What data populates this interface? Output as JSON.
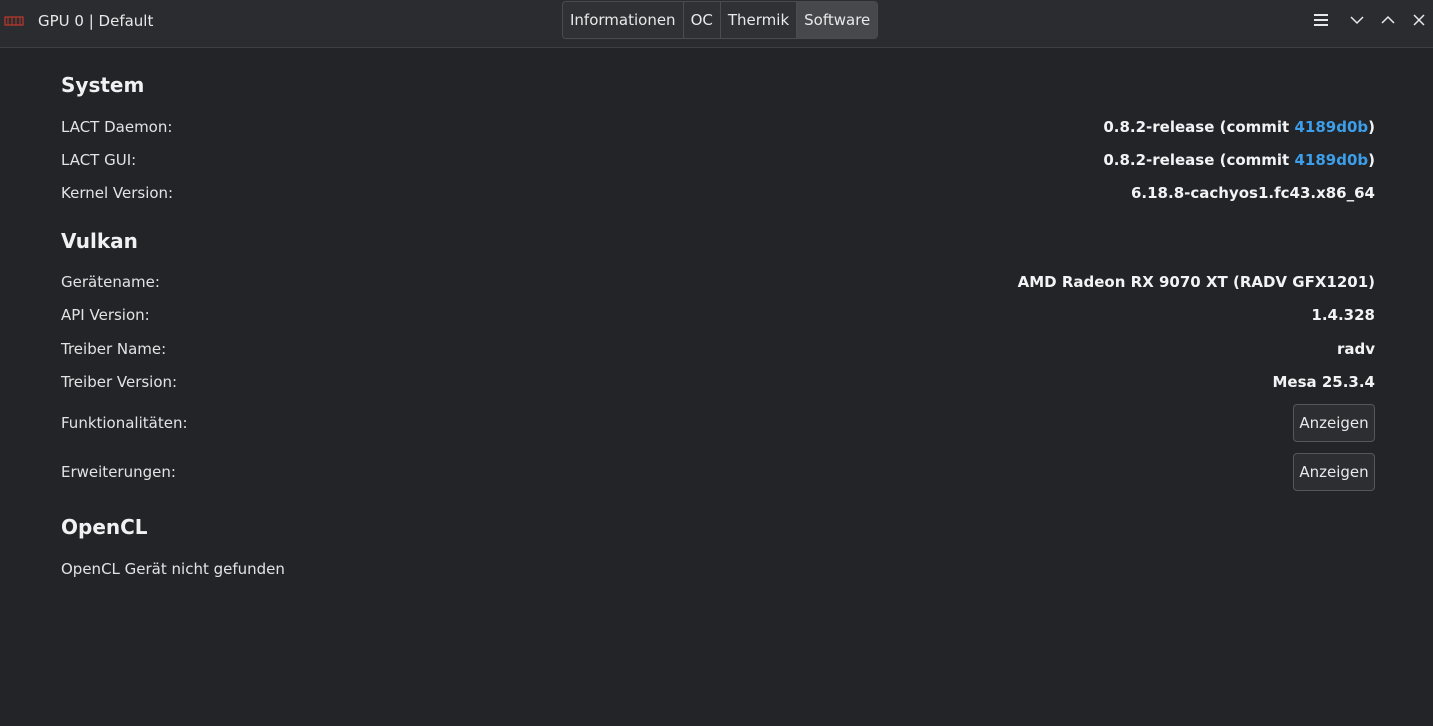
{
  "window": {
    "title": "GPU 0 | Default",
    "icon": "lact-app-icon"
  },
  "tabs": [
    {
      "label": "Informationen",
      "active": false
    },
    {
      "label": "OC",
      "active": false
    },
    {
      "label": "Thermik",
      "active": false
    },
    {
      "label": "Software",
      "active": true
    }
  ],
  "window_controls": {
    "menu_icon": "hamburger-menu-icon",
    "minimize_icon": "chevron-down-icon",
    "maximize_icon": "chevron-up-icon",
    "close_icon": "close-icon"
  },
  "system": {
    "title": "System",
    "daemon_label": "LACT Daemon:",
    "daemon_version_prefix": "0.8.2-release (commit ",
    "daemon_commit": "4189d0b",
    "daemon_version_suffix": ")",
    "gui_label": "LACT GUI:",
    "gui_version_prefix": "0.8.2-release (commit ",
    "gui_commit": "4189d0b",
    "gui_version_suffix": ")",
    "kernel_label": "Kernel Version:",
    "kernel_value": "6.18.8-cachyos1.fc43.x86_64"
  },
  "vulkan": {
    "title": "Vulkan",
    "device_label": "Gerätename:",
    "device_value": "AMD Radeon RX 9070 XT (RADV GFX1201)",
    "api_label": "API Version:",
    "api_value": "1.4.328",
    "driver_name_label": "Treiber Name:",
    "driver_name_value": "radv",
    "driver_version_label": "Treiber Version:",
    "driver_version_value": "Mesa 25.3.4",
    "features_label": "Funktionalitäten:",
    "features_button": "Anzeigen",
    "extensions_label": "Erweiterungen:",
    "extensions_button": "Anzeigen"
  },
  "opencl": {
    "title": "OpenCL",
    "status": "OpenCL Gerät nicht gefunden"
  },
  "colors": {
    "background": "#222427",
    "titlebar": "#2a2c2f",
    "link": "#3d9ee9",
    "active_tab": "#46484c"
  }
}
